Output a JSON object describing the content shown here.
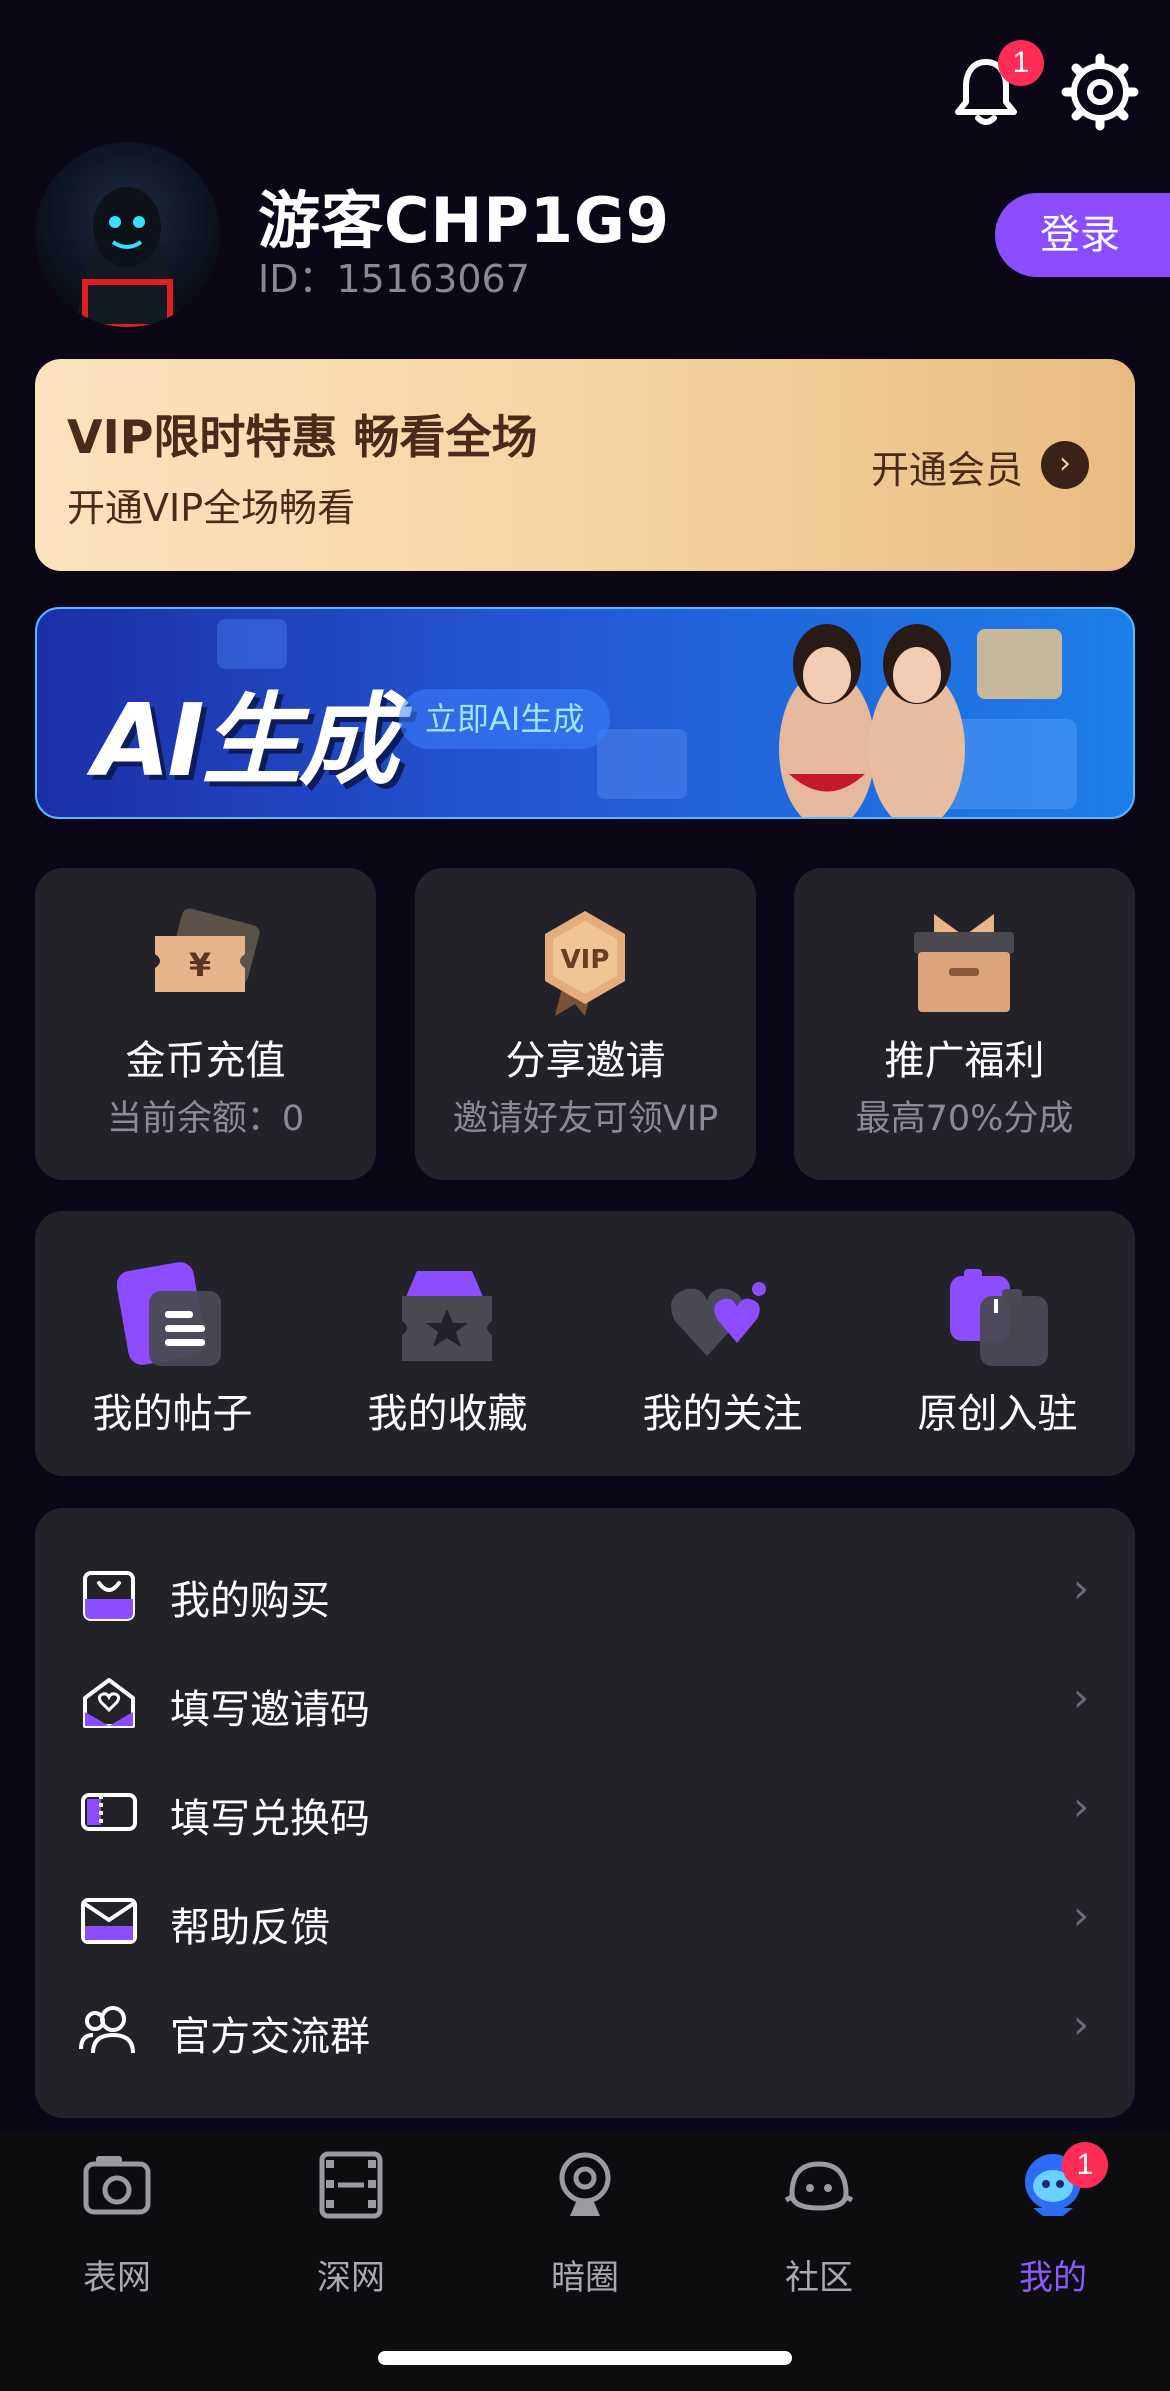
{
  "header": {
    "notifications_badge": "1"
  },
  "profile": {
    "username": "游客CHP1G9",
    "id_text": "ID：15163067",
    "login_label": "登录"
  },
  "vip_banner": {
    "title": "VIP限时特惠 畅看全场",
    "subtitle": "开通VIP全场畅看",
    "cta": "开通会员"
  },
  "ai_banner": {
    "title": "AI生成",
    "pill": "立即AI生成"
  },
  "cards": [
    {
      "title": "金币充值",
      "subtitle": "当前余额：0",
      "icon": "coupon-icon"
    },
    {
      "title": "分享邀请",
      "subtitle": "邀请好友可领VIP",
      "icon": "vip-badge-icon"
    },
    {
      "title": "推广福利",
      "subtitle": "最高70%分成",
      "icon": "gift-box-icon"
    }
  ],
  "quick_actions": [
    {
      "label": "我的帖子",
      "icon": "posts-icon"
    },
    {
      "label": "我的收藏",
      "icon": "favorites-icon"
    },
    {
      "label": "我的关注",
      "icon": "follow-heart-icon"
    },
    {
      "label": "原创入驻",
      "icon": "creator-icon"
    }
  ],
  "menu": [
    {
      "label": "我的购买",
      "icon": "shopping-bag-icon"
    },
    {
      "label": "填写邀请码",
      "icon": "invite-envelope-icon"
    },
    {
      "label": "填写兑换码",
      "icon": "ticket-icon"
    },
    {
      "label": "帮助反馈",
      "icon": "mail-icon"
    },
    {
      "label": "官方交流群",
      "icon": "group-icon"
    }
  ],
  "tabbar": {
    "items": [
      {
        "label": "表网",
        "icon": "camera-icon"
      },
      {
        "label": "深网",
        "icon": "film-icon"
      },
      {
        "label": "暗圈",
        "icon": "webcam-icon"
      },
      {
        "label": "社区",
        "icon": "alien-icon"
      },
      {
        "label": "我的",
        "icon": "profile-mascot-icon"
      }
    ],
    "active_index": 4,
    "profile_badge": "1"
  },
  "colors": {
    "background": "#0b0717",
    "accent": "#8b4dff",
    "card": "#232229",
    "vip_gold": "#f6d2a1",
    "badge": "#ff2c55"
  }
}
